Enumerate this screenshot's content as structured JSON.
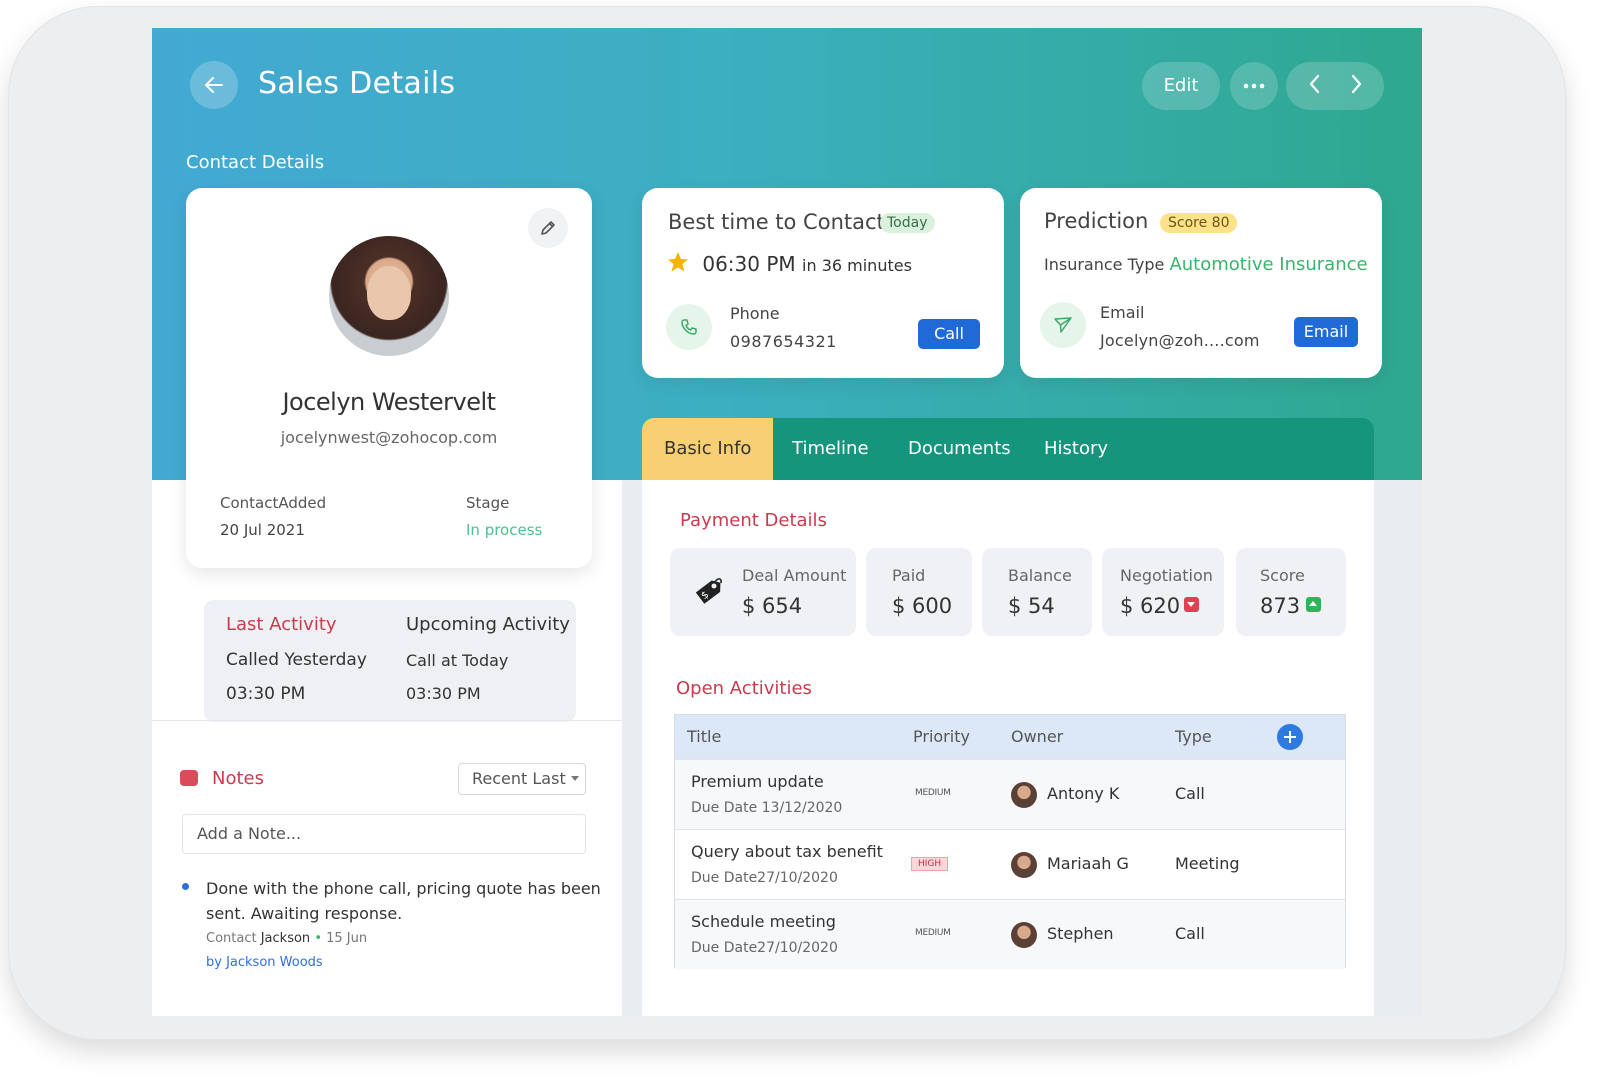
{
  "header": {
    "title": "Sales Details",
    "edit_label": "Edit"
  },
  "contact_section_label": "Contact Details",
  "profile": {
    "name": "Jocelyn Westervelt",
    "email": "jocelynwest@zohocop.com",
    "added_label": "ContactAdded",
    "added_value": "20 Jul 2021",
    "stage_label": "Stage",
    "stage_value": "In process"
  },
  "best_time": {
    "title": "Best time to Contact",
    "badge": "Today",
    "time": "06:30 PM",
    "relative": "in 36 minutes",
    "phone_label": "Phone",
    "phone_value": "0987654321",
    "call_button": "Call"
  },
  "prediction": {
    "title": "Prediction",
    "score_badge": "Score 80",
    "insurance_label": "Insurance Type",
    "insurance_value": "Automotive Insurance",
    "email_label": "Email",
    "email_value": "Jocelyn@zoh....com",
    "email_button": "Email"
  },
  "activity": {
    "last_title": "Last Activity",
    "last_line1": "Called Yesterday",
    "last_line2": "03:30 PM",
    "upcoming_title": "Upcoming Activity",
    "upcoming_line1": "Call at Today",
    "upcoming_line2": "03:30 PM"
  },
  "notes": {
    "title": "Notes",
    "sort_value": "Recent Last",
    "input_placeholder": "Add a Note...",
    "items": [
      {
        "text": "Done with the phone call, pricing quote has been sent. Awaiting response.",
        "contact_prefix": "Contact",
        "contact_name": "Jackson",
        "date": "15 Jun",
        "author": "by Jackson Woods"
      }
    ]
  },
  "tabs": [
    {
      "label": "Basic Info",
      "active": true
    },
    {
      "label": "Timeline"
    },
    {
      "label": "Documents"
    },
    {
      "label": "History"
    }
  ],
  "payment": {
    "title": "Payment Details",
    "stats": [
      {
        "label": "Deal Amount",
        "value": "$ 654"
      },
      {
        "label": "Paid",
        "value": "$ 600"
      },
      {
        "label": "Balance",
        "value": "$ 54"
      },
      {
        "label": "Negotiation",
        "value": "$ 620",
        "trend": "down"
      },
      {
        "label": "Score",
        "value": "873",
        "trend": "up"
      }
    ]
  },
  "open_activities": {
    "title": "Open Activities",
    "columns": [
      "Title",
      "Priority",
      "Owner",
      "Type"
    ],
    "rows": [
      {
        "title": "Premium update",
        "due": "Due Date 13/12/2020",
        "priority": "MEDIUM",
        "owner": "Antony K",
        "type": "Call"
      },
      {
        "title": "Query about tax benefit",
        "due": "Due Date27/10/2020",
        "priority": "HIGH",
        "owner": "Mariaah G",
        "type": "Meeting"
      },
      {
        "title": "Schedule meeting",
        "due": "Due Date27/10/2020",
        "priority": "MEDIUM",
        "owner": "Stephen",
        "type": "Call"
      }
    ]
  },
  "colors": {
    "accent_teal": "#14957c",
    "hero_start": "#43a9d3",
    "hero_end": "#2ea88f",
    "tab_active": "#f9cf73",
    "primary_blue": "#1f6ad6",
    "section_red": "#c83b4f",
    "success_green": "#38b56b"
  },
  "icons": {
    "back": "arrow-left-icon",
    "more": "ellipsis-icon",
    "prev": "chevron-left-icon",
    "next": "chevron-right-icon",
    "edit": "pencil-icon",
    "star": "star-icon",
    "phone": "phone-icon",
    "send": "send-icon",
    "tag": "price-tag-icon",
    "notes": "notes-icon",
    "add": "plus-icon"
  }
}
